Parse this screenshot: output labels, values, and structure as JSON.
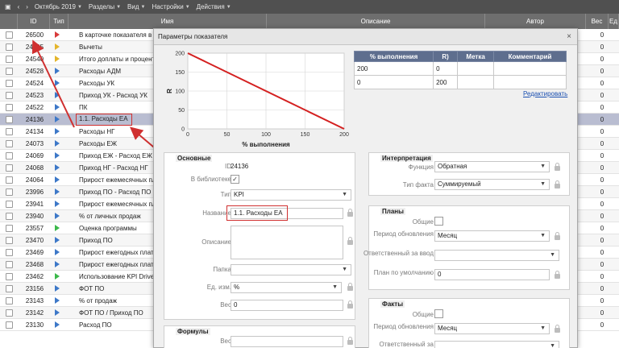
{
  "toolbar": {
    "period": "Октябрь 2019",
    "menus": [
      "Разделы",
      "Вид",
      "Настройки",
      "Действия"
    ]
  },
  "columns": {
    "id": "ID",
    "type": "Тип",
    "name": "Имя",
    "description": "Описание",
    "author": "Автор",
    "weight": "Вес",
    "ed": "Ед"
  },
  "rows": [
    {
      "id": "26500",
      "name": "В карточке показателя в",
      "flag": "#d83b3b",
      "ves": "0"
    },
    {
      "id": "24795",
      "name": "Вычеты",
      "flag": "#e4b52a",
      "ves": "0"
    },
    {
      "id": "24540",
      "name": "Итого доплаты и процент",
      "flag": "#e4b52a",
      "ves": "0"
    },
    {
      "id": "24528",
      "name": "Расходы АДМ",
      "flag": "#3d78c8",
      "ves": "0"
    },
    {
      "id": "24524",
      "name": "Расходы УК",
      "flag": "#3d78c8",
      "ves": "0"
    },
    {
      "id": "24523",
      "name": "Приход УК - Расход УК",
      "flag": "#3d78c8",
      "ves": "0"
    },
    {
      "id": "24522",
      "name": "ПК",
      "flag": "#3d78c8",
      "ves": "0"
    },
    {
      "id": "24136",
      "name": "1.1. Расходы ЕА",
      "flag": "#3d78c8",
      "ves": "0",
      "selected": true
    },
    {
      "id": "24134",
      "name": "Расходы НГ",
      "flag": "#3d78c8",
      "ves": "0"
    },
    {
      "id": "24073",
      "name": "Расходы ЕЖ",
      "flag": "#3d78c8",
      "ves": "0"
    },
    {
      "id": "24069",
      "name": "Приход ЕЖ - Расход ЕЖ",
      "flag": "#3d78c8",
      "ves": "0"
    },
    {
      "id": "24068",
      "name": "Приход НГ - Расход НГ",
      "flag": "#3d78c8",
      "ves": "0"
    },
    {
      "id": "24064",
      "name": "Прирост ежемесячных пла",
      "flag": "#3d78c8",
      "ves": "0"
    },
    {
      "id": "23996",
      "name": "Приход ПО - Расход ПО",
      "flag": "#3d78c8",
      "ves": "0"
    },
    {
      "id": "23941",
      "name": "Прирост ежемесячных пла",
      "flag": "#3d78c8",
      "ves": "0"
    },
    {
      "id": "23940",
      "name": "% от личных продаж",
      "flag": "#3d78c8",
      "ves": "0"
    },
    {
      "id": "23557",
      "name": "Оценка программы",
      "flag": "#3bb84a",
      "ves": "0"
    },
    {
      "id": "23470",
      "name": "Приход ПО",
      "flag": "#3d78c8",
      "ves": "0"
    },
    {
      "id": "23469",
      "name": "Прирост ежегодных плат",
      "flag": "#3d78c8",
      "ves": "0"
    },
    {
      "id": "23468",
      "name": "Прирост ежегодных плат",
      "flag": "#3d78c8",
      "ves": "0"
    },
    {
      "id": "23462",
      "name": "Использование KPI Drive",
      "flag": "#3bb84a",
      "ves": "0"
    },
    {
      "id": "23156",
      "name": "ФОТ ПО",
      "flag": "#3d78c8",
      "ves": "0"
    },
    {
      "id": "23143",
      "name": "% от продаж",
      "flag": "#3d78c8",
      "ves": "0"
    },
    {
      "id": "23142",
      "name": "ФОТ ПО / Приход ПО",
      "flag": "#3d78c8",
      "ves": "0"
    },
    {
      "id": "23130",
      "name": "Расход ПО",
      "flag": "#3d78c8",
      "ves": "0"
    }
  ],
  "modal": {
    "title": "Параметры показателя",
    "close": "×",
    "edit_link": "Редактировать",
    "table": {
      "headers": [
        "% выполнения",
        "R)",
        "Метка",
        "Комментарий"
      ],
      "rows": [
        [
          "200",
          "0",
          "",
          ""
        ],
        [
          "0",
          "200",
          "",
          ""
        ]
      ]
    },
    "basic": {
      "title": "Основные",
      "id_label": "ID",
      "id_value": "24136",
      "lib_label": "В библиотеке",
      "lib_check": "✓",
      "type_label": "Тип",
      "type_value": "KPI",
      "name_label": "Название",
      "name_value": "1.1. Расходы ЕА",
      "desc_label": "Описание",
      "folder_label": "Папка",
      "folder_value": "",
      "unit_label": "Ед. изм.",
      "unit_value": "%",
      "weight_label": "Вес",
      "weight_value": "0"
    },
    "formulas": {
      "title": "Формулы",
      "weight_label": "Вес"
    },
    "interp": {
      "title": "Интерпретация",
      "func_label": "Функция",
      "func_value": "Обратная",
      "fact_label": "Тип факта",
      "fact_value": "Суммируемый"
    },
    "plans": {
      "title": "Планы",
      "common_label": "Общие",
      "period_label": "Период обновления",
      "period_value": "Месяц",
      "resp_label": "Ответственный за ввод",
      "resp_value": "",
      "default_label": "План по умолчанию",
      "default_value": "0"
    },
    "facts": {
      "title": "Факты",
      "common_label": "Общие",
      "period_label": "Период обновления",
      "period_value": "Месяц",
      "resp_label": "Ответственный за"
    }
  },
  "chart_data": {
    "type": "line",
    "x": [
      0,
      200
    ],
    "series": [
      {
        "values": [
          200,
          0
        ],
        "color": "#d42020"
      }
    ],
    "xlabel": "% выполнения",
    "ylabel": "R",
    "xticks": [
      0,
      50,
      100,
      150,
      200
    ],
    "yticks": [
      0,
      50,
      100,
      150,
      200
    ],
    "xlim": [
      0,
      200
    ],
    "ylim": [
      0,
      200
    ],
    "grid": true
  }
}
